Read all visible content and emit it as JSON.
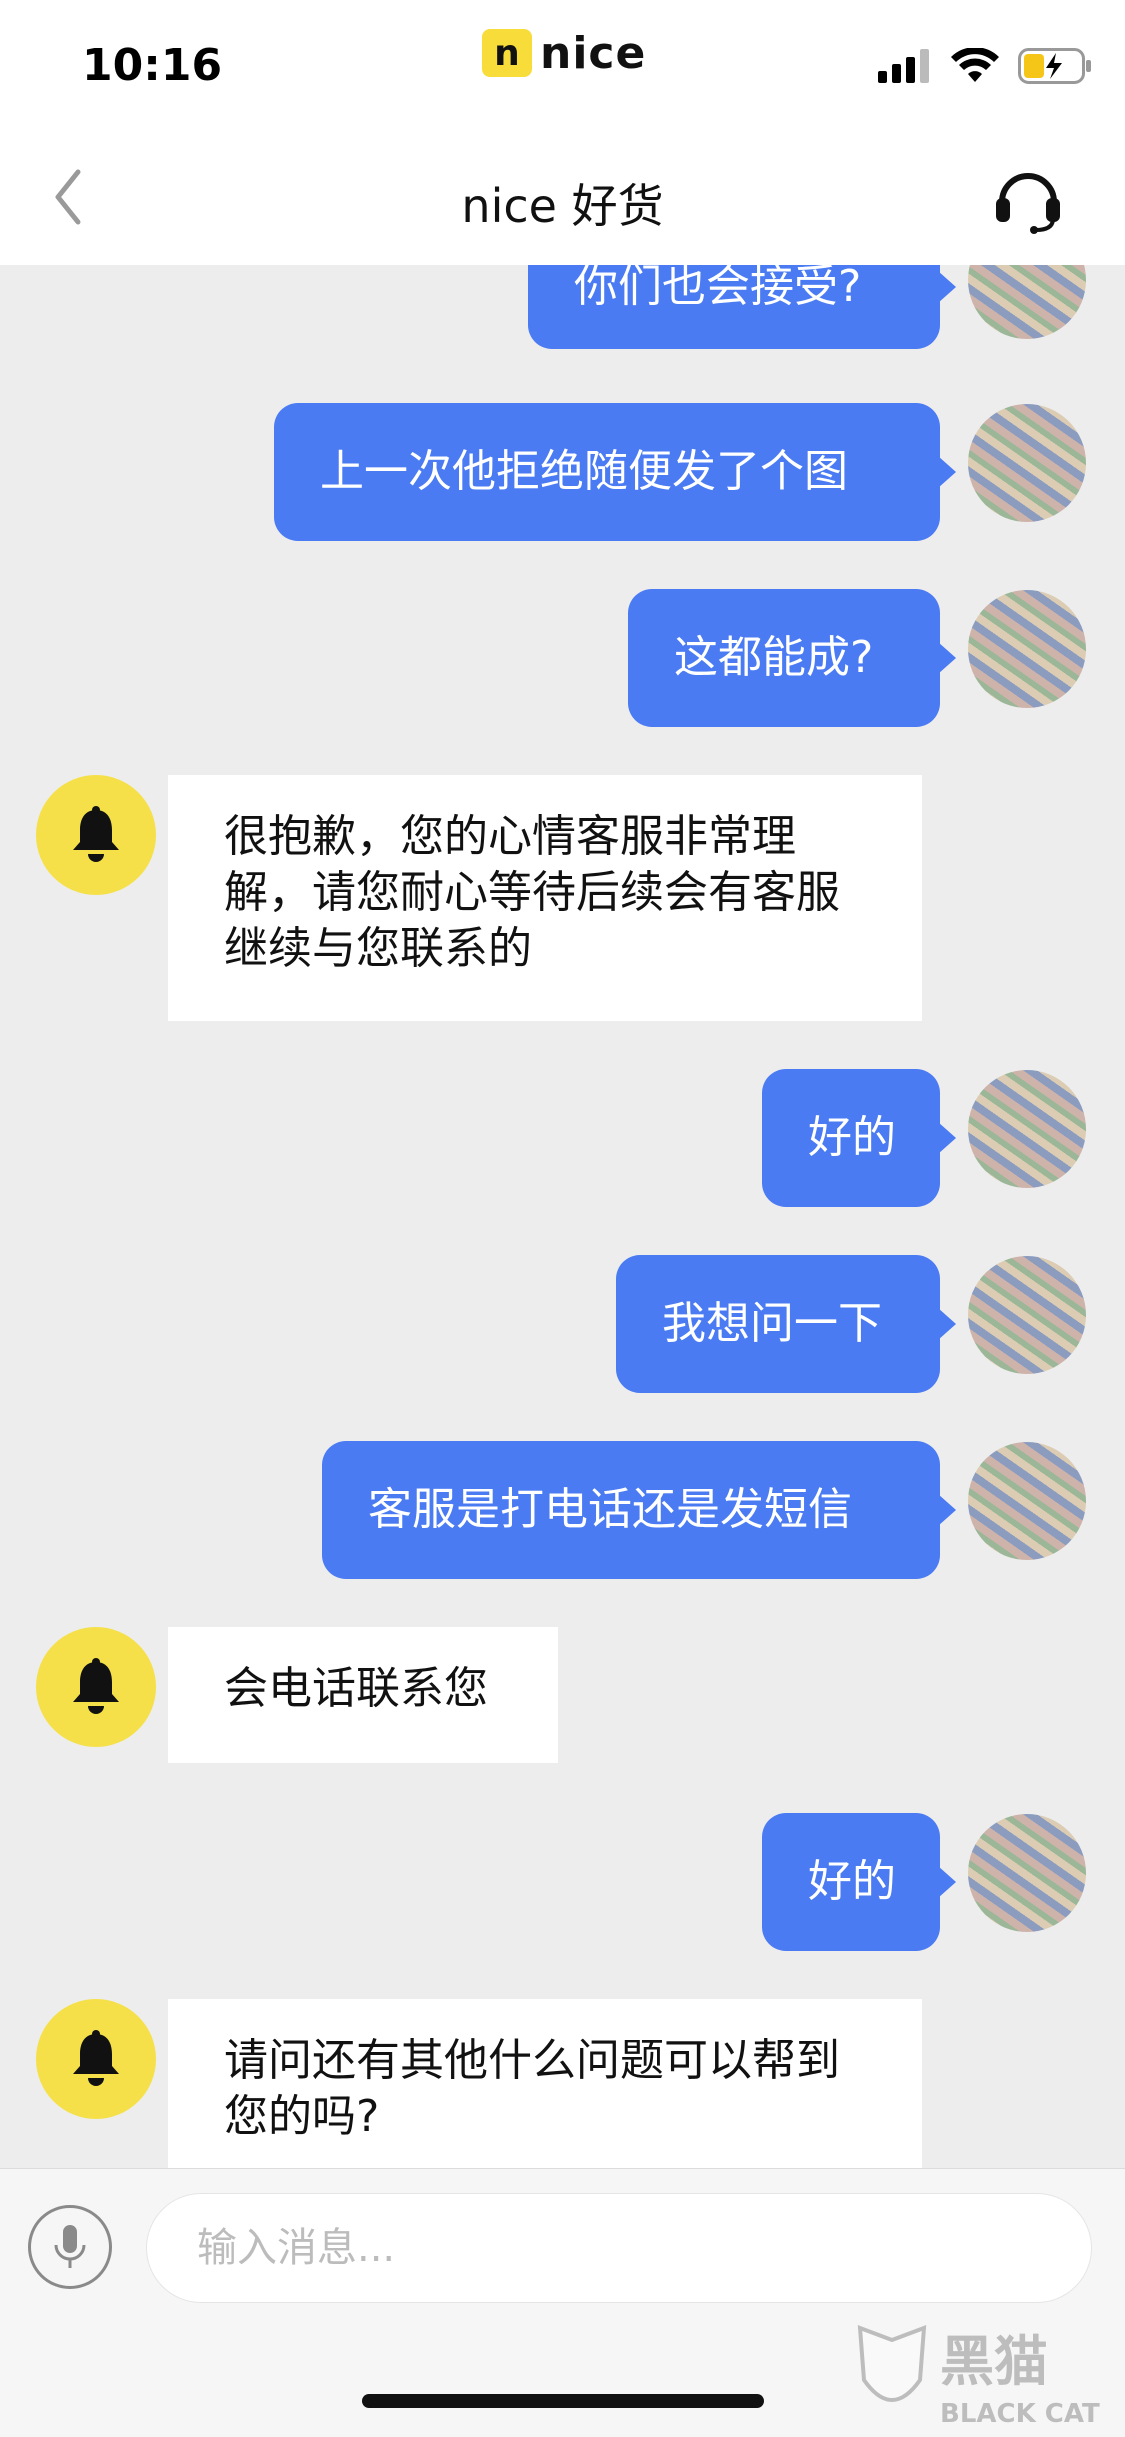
{
  "status_bar": {
    "time": "10:16",
    "brand_letter": "n",
    "brand_word": "nice",
    "icons": [
      "signal-icon",
      "wifi-icon",
      "battery-charging-icon"
    ]
  },
  "nav": {
    "title": "nice 好货",
    "back_icon": "chevron-left-icon",
    "support_icon": "headset-icon"
  },
  "messages": [
    {
      "from": "me",
      "text": "你们也会接受?"
    },
    {
      "from": "me",
      "text": "上一次他拒绝随便发了个图"
    },
    {
      "from": "me",
      "text": "这都能成?"
    },
    {
      "from": "bot",
      "text": "很抱歉，您的心情客服非常理解，请您耐心等待后续会有客服继续与您联系的"
    },
    {
      "from": "me",
      "text": "好的"
    },
    {
      "from": "me",
      "text": "我想问一下"
    },
    {
      "from": "me",
      "text": "客服是打电话还是发短信"
    },
    {
      "from": "bot",
      "text": "会电话联系您"
    },
    {
      "from": "me",
      "text": "好的"
    },
    {
      "from": "bot",
      "text": "请问还有其他什么问题可以帮到您的吗?"
    }
  ],
  "input": {
    "placeholder": "输入消息..."
  },
  "colors": {
    "my_bubble": "#4a7bf3",
    "bot_avatar": "#f5e04a",
    "background": "#ededed"
  },
  "watermark": {
    "text_cn": "黑猫",
    "text_en": "BLACK CAT"
  }
}
